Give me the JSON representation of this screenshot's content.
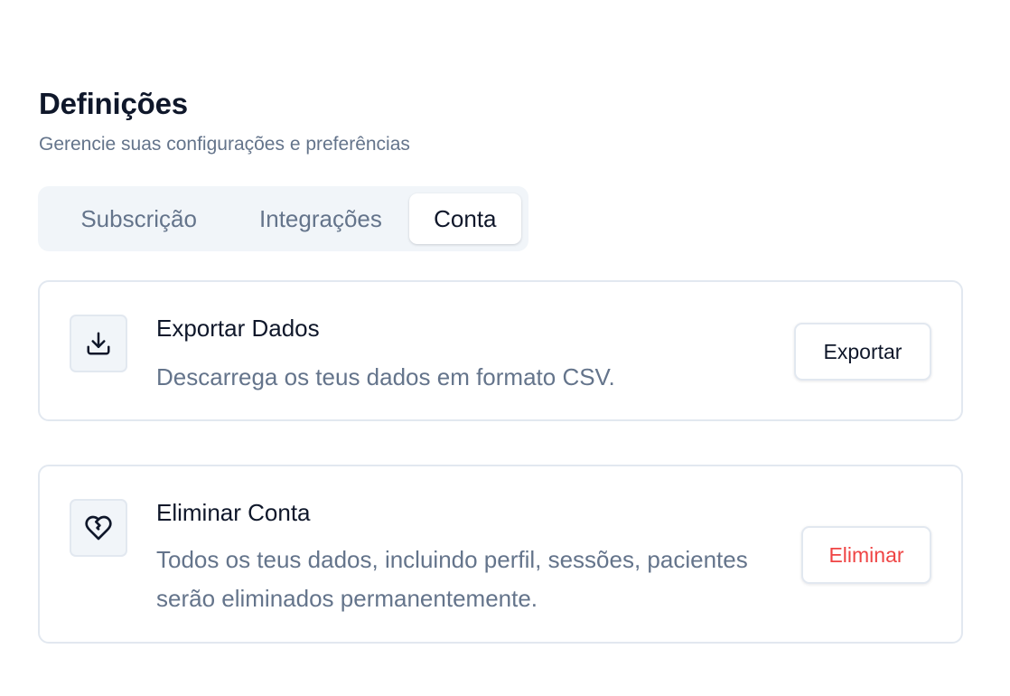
{
  "header": {
    "title": "Definições",
    "subtitle": "Gerencie suas configurações e preferências"
  },
  "tabs": [
    {
      "label": "Subscrição",
      "active": false
    },
    {
      "label": "Integrações",
      "active": false
    },
    {
      "label": "Conta",
      "active": true
    }
  ],
  "export_card": {
    "icon": "download-icon",
    "title": "Exportar Dados",
    "description": "Descarrega os teus dados em formato CSV.",
    "button_label": "Exportar"
  },
  "delete_card": {
    "icon": "heart-crack-icon",
    "title": "Eliminar Conta",
    "description": "Todos os teus dados, incluindo perfil, sessões, pacientes serão eliminados permanentemente.",
    "button_label": "Eliminar",
    "button_color": "#ef4444"
  }
}
